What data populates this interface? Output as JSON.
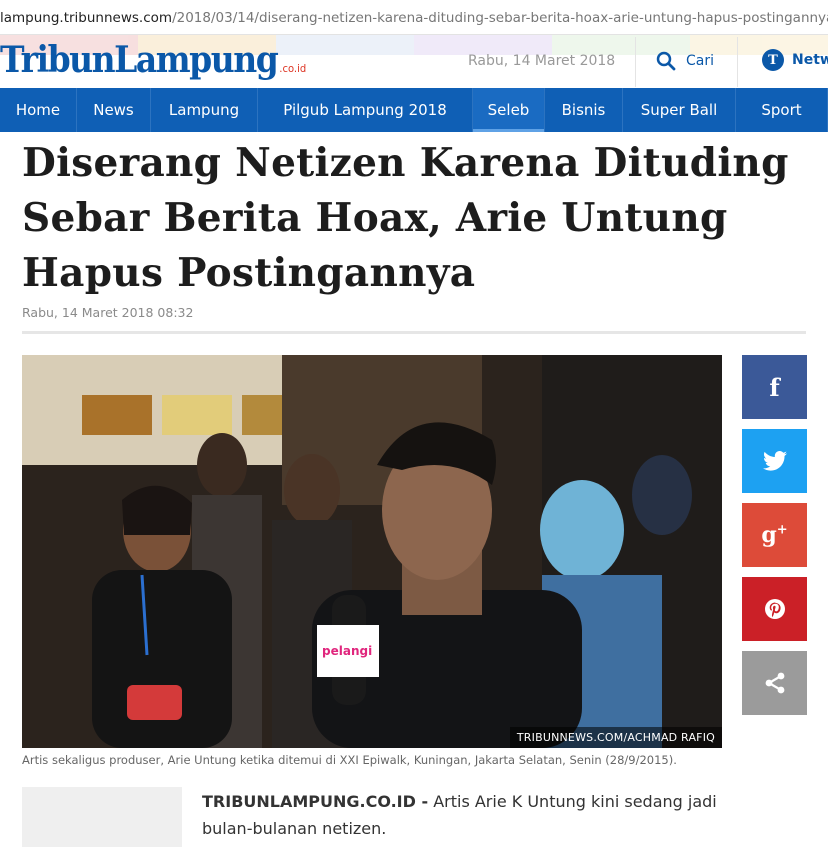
{
  "browser": {
    "url_domain": "lampung.tribunnews.com",
    "url_path": "/2018/03/14/diserang-netizen-karena-dituding-sebar-berita-hoax-arie-untung-hapus-postingannya"
  },
  "header": {
    "logo_text": "TribunLampung",
    "logo_domain": ".co.id",
    "date": "Rabu, 14 Maret 2018",
    "search_label": "Cari",
    "network_label": "Netw",
    "network_icon_letter": "T",
    "accent_color": "#0f5fb5"
  },
  "nav": {
    "items": [
      {
        "label": "Home"
      },
      {
        "label": "News"
      },
      {
        "label": "Lampung"
      },
      {
        "label": "Pilgub Lampung 2018"
      },
      {
        "label": "Seleb",
        "active": true
      },
      {
        "label": "Bisnis"
      },
      {
        "label": "Super Ball"
      },
      {
        "label": "Sport"
      }
    ]
  },
  "article": {
    "title": "Diserang Netizen Karena Dituding Sebar Berita Hoax, Arie Untung Hapus Postingannya",
    "date": "Rabu, 14 Maret 2018 08:32",
    "photo_credit": "TRIBUNNEWS.COM/ACHMAD RAFIQ",
    "photo_caption": "Artis sekaligus produser, Arie Untung ketika ditemui di XXI Epiwalk, Kuningan, Jakarta Selatan, Senin (28/9/2015).",
    "mic_label": "pelangi",
    "lead_source": "TRIBUNLAMPUNG.CO.ID -",
    "lead_text": " Artis Arie K Untung kini sedang jadi bulan-bulanan netizen."
  },
  "share": [
    {
      "name": "facebook",
      "glyph": "f",
      "color": "#3b5998"
    },
    {
      "name": "twitter",
      "glyph": "🐦",
      "color": "#1da1f2"
    },
    {
      "name": "google-plus",
      "glyph": "g+",
      "color": "#dd4b39"
    },
    {
      "name": "pinterest",
      "glyph": "P",
      "color": "#cb2027"
    },
    {
      "name": "share",
      "glyph": "<",
      "color": "#9b9b9b"
    }
  ]
}
